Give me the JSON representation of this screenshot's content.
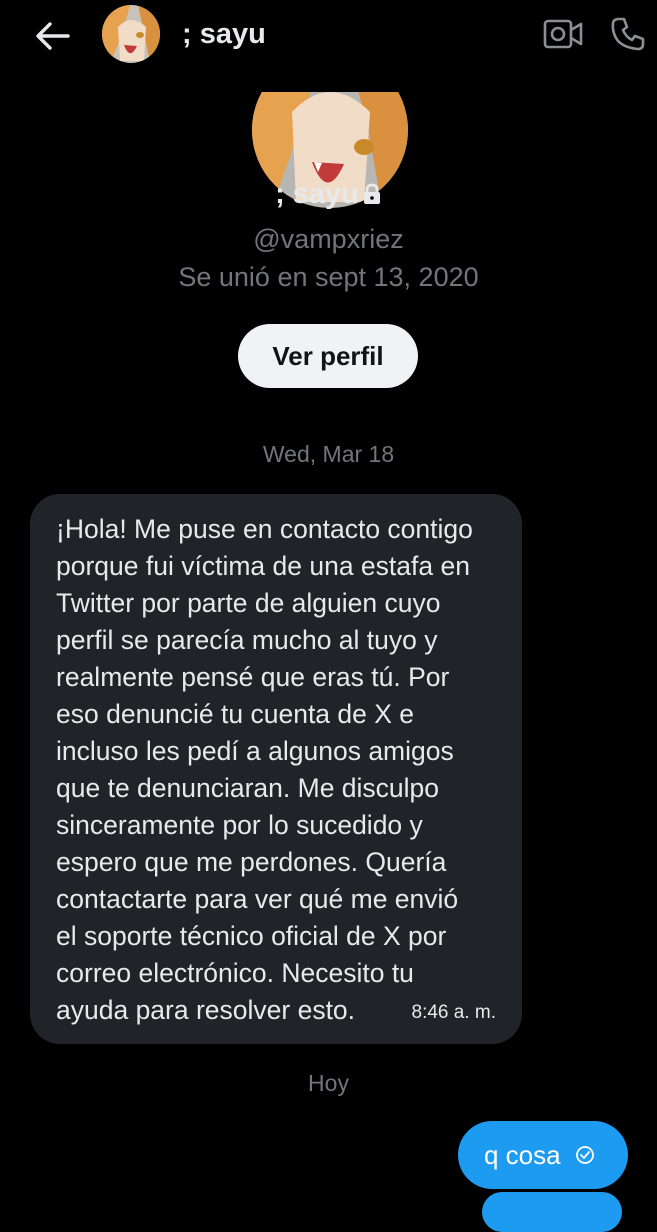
{
  "header": {
    "back_icon": "arrow-left-icon",
    "name": "; sayu",
    "video_icon": "video-camera-icon",
    "call_icon": "phone-icon"
  },
  "profile": {
    "name": "; sayu",
    "lock_icon": "lock-icon",
    "handle": "@vampxriez",
    "joined": "Se unió en sept 13, 2020",
    "view_profile_label": "Ver perfil"
  },
  "conversation": {
    "separators": [
      "Wed, Mar 18",
      "Hoy"
    ],
    "incoming_message": {
      "text": "¡Hola! Me puse en contacto contigo\nporque fui víctima de una estafa en\nTwitter por parte de alguien cuyo\nperfil se parecía mucho al tuyo y\nrealmente pensé que eras tú. Por\neso denuncié tu cuenta de X e\nincluso les pedí a algunos amigos\nque te denunciaran. Me disculpo\nsinceramente por lo sucedido y\nespero que me perdones. Quería\ncontactarte para ver qué me envió\nel soporte técnico oficial de X por\ncorreo electrónico. Necesito tu\nayuda para resolver esto.",
      "time": "8:46 a. m."
    },
    "outgoing_message": {
      "text": "q cosa",
      "status_icon": "read-check-icon"
    }
  },
  "colors": {
    "background": "#000000",
    "incoming_bubble": "#202327",
    "outgoing_bubble": "#1d9bf0",
    "secondary_text": "#71767b",
    "primary_text": "#e7e9ea"
  }
}
